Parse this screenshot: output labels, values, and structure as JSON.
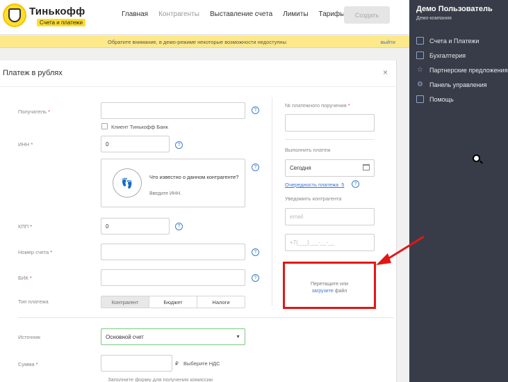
{
  "header": {
    "brand": "Тинькофф",
    "brand_sub": "Счета и платежи",
    "nav": [
      "Главная",
      "Контрагенты",
      "Выставление счета",
      "Лимиты",
      "Тарифы"
    ],
    "create_button": "Создать"
  },
  "notice": {
    "text": "Обратите внимание, в демо-режиме некоторые возможности недоступны",
    "exit": "выйти"
  },
  "sidebar": {
    "user": "Демо Пользователь",
    "company": "Демо-компания",
    "items": [
      {
        "label": "Счета и Платежи",
        "icon": "phone-icon"
      },
      {
        "label": "Бухгалтерия",
        "icon": "calendar-icon"
      },
      {
        "label": "Партнерские предложения",
        "icon": "star-icon"
      },
      {
        "label": "Панель управления",
        "icon": "gear-icon"
      },
      {
        "label": "Помощь",
        "icon": "book-icon"
      }
    ]
  },
  "panel": {
    "title": "Платеж в рублях",
    "close": "×",
    "recipient_label": "Получатель",
    "tinkoff_client": "Клиент Тинькофф Банк",
    "inn_label": "ИНН",
    "inn_value": "0",
    "bank_card_text": "Что известно о данном контрагенте?",
    "bank_card_sub": "Введите ИНН.",
    "kpp_label": "КПП",
    "kpp_value": "0",
    "account_label": "Номер счета",
    "bik_label": "БИК",
    "payment_type_label": "Тип платежа",
    "payment_types": [
      "Контрагент",
      "Бюджет",
      "Налоги"
    ],
    "source_label": "Источник",
    "source_value": "Основной счет",
    "sum_label": "Сумма",
    "currency": "₽",
    "vat": "Выберите НДС",
    "commission_hint": "Заполните форму для получения комиссии",
    "order_no_label": "№ платежного поручения",
    "execute_label": "Выполнить платеж",
    "execute_value": "Сегодня",
    "priority_link": "Очередность платежа",
    "priority_value": "5",
    "notify_label": "Уведомить контрагента",
    "email_placeholder": "email",
    "phone_placeholder": "+7(___)___-__-__",
    "dropzone_text": "Перетащите или",
    "dropzone_link": "загрузите",
    "dropzone_tail": "файл"
  },
  "colors": {
    "accent_yellow": "#ffdd2d",
    "sidebar_bg": "#383c48",
    "highlight_red": "#e31616",
    "link_blue": "#3b75d8"
  }
}
